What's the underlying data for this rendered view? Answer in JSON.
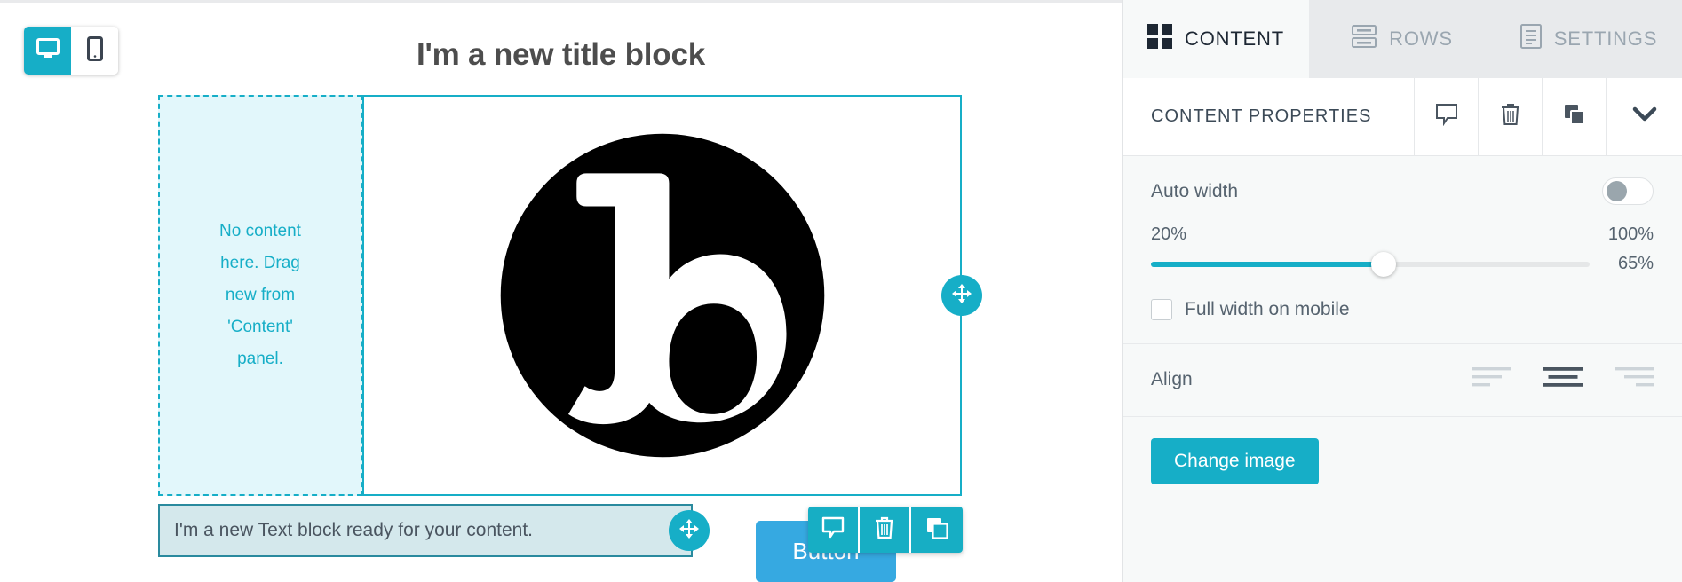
{
  "stage": {
    "device_toggle": {
      "desktop_label": "desktop-view",
      "mobile_label": "mobile-view",
      "active": "desktop"
    },
    "title_block": {
      "text": "I'm a new title block"
    },
    "empty_column": {
      "text": "No content here. Drag new from 'Content' panel."
    },
    "image_block": {
      "alt": "logo image"
    },
    "text_block": {
      "text": "I'm a new Text block ready for your content."
    },
    "button_block": {
      "label": "Button"
    },
    "float_toolbar": {
      "comment_label": "comment-icon",
      "delete_label": "trash-icon",
      "duplicate_label": "duplicate-icon"
    }
  },
  "panel": {
    "tabs": [
      {
        "label": "CONTENT",
        "icon": "grid-icon",
        "active": true
      },
      {
        "label": "ROWS",
        "icon": "rows-icon",
        "active": false
      },
      {
        "label": "SETTINGS",
        "icon": "document-icon",
        "active": false
      }
    ],
    "header": {
      "title": "CONTENT PROPERTIES",
      "icons": [
        "comment-icon",
        "trash-icon",
        "duplicate-icon",
        "chevron-down-icon"
      ]
    },
    "auto_width": {
      "label": "Auto width",
      "enabled": false
    },
    "width_slider": {
      "min_label": "20%",
      "max_label": "100%",
      "value_label": "65%",
      "fill_percent": 53
    },
    "full_width_mobile": {
      "label": "Full width on mobile",
      "checked": false
    },
    "align": {
      "label": "Align",
      "options": [
        "left",
        "center",
        "right"
      ],
      "selected": "center"
    },
    "change_image_button": {
      "label": "Change image"
    }
  },
  "colors": {
    "accent": "#16aec7",
    "panel_bg": "#f7f9f9",
    "tab_inactive_bg": "#e8eaec",
    "button_blue": "#36a9e1",
    "text_dark": "#3c4a57"
  }
}
